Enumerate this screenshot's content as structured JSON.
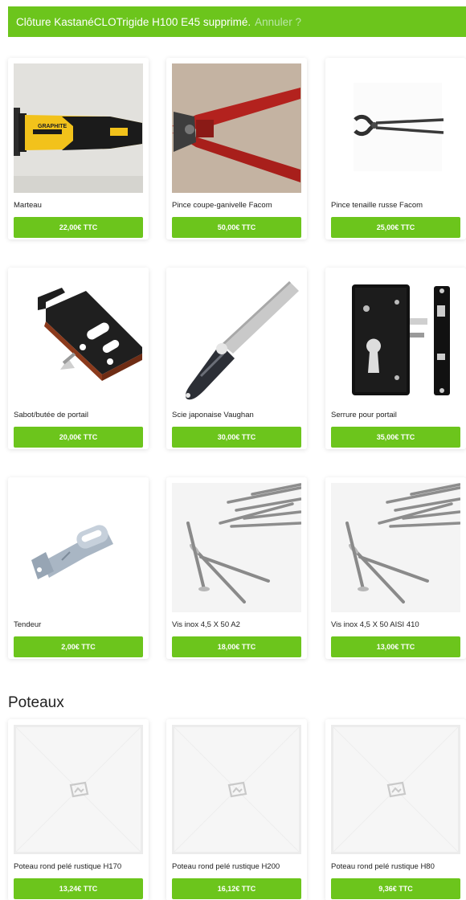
{
  "notice": {
    "message": "Clôture KastanéCLOTrigide H100 E45 supprimé.",
    "undo_label": "Annuler ?"
  },
  "colors": {
    "accent": "#6cc51c",
    "undo": "#b9e6a6"
  },
  "products": [
    {
      "name": "Marteau",
      "price": "22,00€ TTC",
      "image": "hammer"
    },
    {
      "name": "Pince coupe-ganivelle Facom",
      "price": "50,00€ TTC",
      "image": "bolt-cutter"
    },
    {
      "name": "Pince tenaille russe Facom",
      "price": "25,00€ TTC",
      "image": "pincers"
    },
    {
      "name": "Sabot/butée de portail",
      "price": "20,00€ TTC",
      "image": "gate-stop"
    },
    {
      "name": "Scie japonaise Vaughan",
      "price": "30,00€ TTC",
      "image": "japanese-saw"
    },
    {
      "name": "Serrure pour portail",
      "price": "35,00€ TTC",
      "image": "gate-lock"
    },
    {
      "name": "Tendeur",
      "price": "2,00€ TTC",
      "image": "tensioner"
    },
    {
      "name": "Vis inox 4,5 X 50 A2",
      "price": "18,00€ TTC",
      "image": "screws"
    },
    {
      "name": "Vis inox 4,5 X 50 AISI 410",
      "price": "13,00€ TTC",
      "image": "screws"
    }
  ],
  "section": {
    "title": "Poteaux"
  },
  "posts": [
    {
      "name": "Poteau rond pelé rustique H170",
      "price": "13,24€ TTC",
      "image": "placeholder"
    },
    {
      "name": "Poteau rond pelé rustique H200",
      "price": "16,12€ TTC",
      "image": "placeholder"
    },
    {
      "name": "Poteau rond pelé rustique H80",
      "price": "9,36€ TTC",
      "image": "placeholder"
    }
  ]
}
